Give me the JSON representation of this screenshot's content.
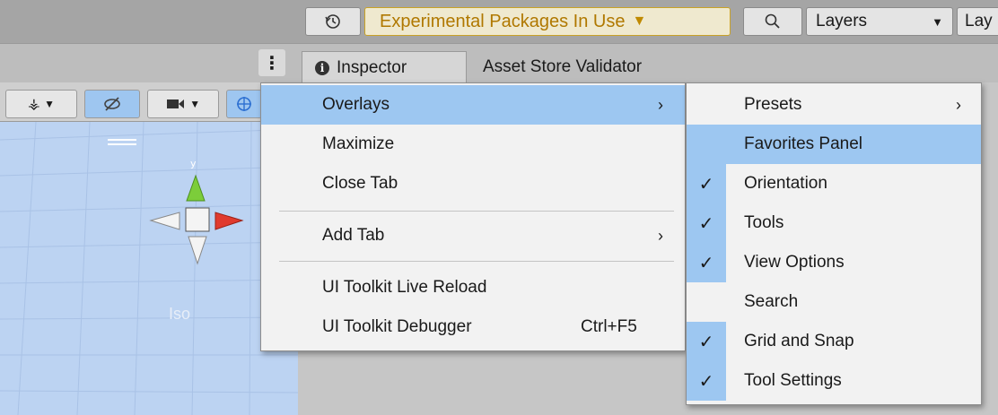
{
  "toolbar": {
    "experimental_label": "Experimental Packages In Use",
    "layers_label": "Layers",
    "layout_label": "Lay"
  },
  "tabs": {
    "inspector": "Inspector",
    "asset_store": "Asset Store Validator"
  },
  "scene": {
    "iso_label": "Iso"
  },
  "menu": {
    "overlays": "Overlays",
    "maximize": "Maximize",
    "close_tab": "Close Tab",
    "add_tab": "Add Tab",
    "live_reload": "UI Toolkit Live Reload",
    "debugger": "UI Toolkit Debugger",
    "debugger_shortcut": "Ctrl+F5"
  },
  "submenu": {
    "presets": "Presets",
    "favorites_panel": "Favorites Panel",
    "orientation": "Orientation",
    "tools": "Tools",
    "view_options": "View Options",
    "search": "Search",
    "grid_and_snap": "Grid and Snap",
    "tool_settings": "Tool Settings",
    "checked": [
      "Orientation",
      "Tools",
      "View Options",
      "Grid and Snap",
      "Tool Settings"
    ]
  },
  "colors": {
    "highlight": "#9dc7f1",
    "experimental_text": "#b07800",
    "scene_bg": "#bcd3f2"
  }
}
